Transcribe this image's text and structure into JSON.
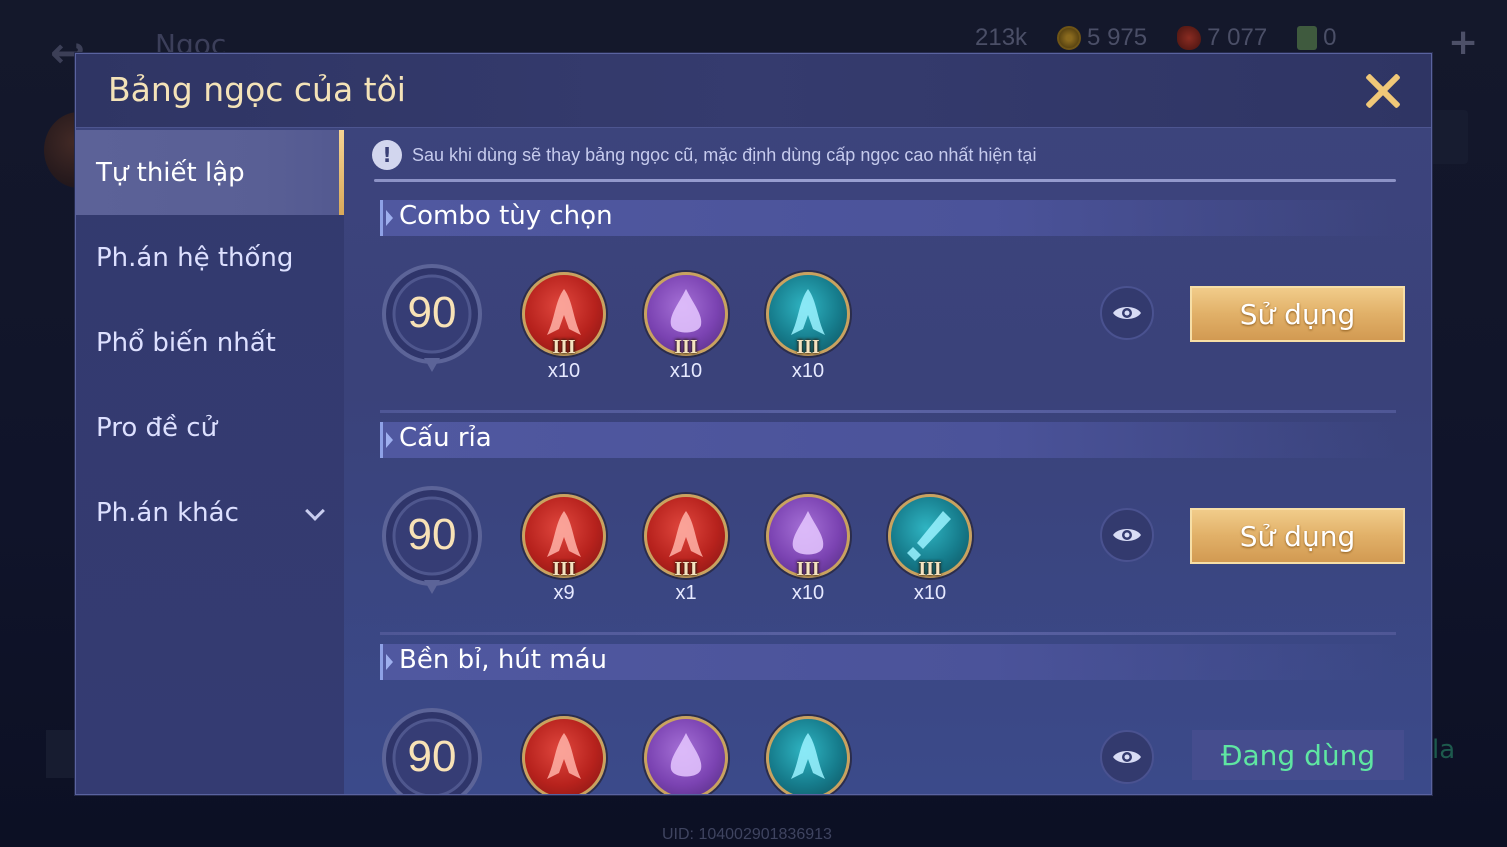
{
  "background": {
    "title": "Ngọc",
    "currencies": [
      {
        "icon": "gem-icon",
        "value": "213k"
      },
      {
        "icon": "gold-coin-icon",
        "value": "5 975"
      },
      {
        "icon": "ruby-icon",
        "value": "7 077"
      },
      {
        "icon": "card-icon",
        "value": "0"
      }
    ],
    "side_text": "la",
    "uid": "UID: 104002901836913"
  },
  "modal": {
    "title": "Bảng ngọc của tôi"
  },
  "sidebar": {
    "items": [
      {
        "label": "Tự thiết lập",
        "active": true
      },
      {
        "label": "Ph.án hệ thống",
        "active": false
      },
      {
        "label": "Phổ biến nhất",
        "active": false
      },
      {
        "label": "Pro đề cử",
        "active": false
      },
      {
        "label": "Ph.án khác",
        "active": false,
        "has_dropdown": true
      }
    ]
  },
  "notice": "Sau khi dùng sẽ thay bảng ngọc cũ, mặc định dùng cấp ngọc cao nhất hiện tại",
  "sections": [
    {
      "title": "Combo tùy chọn",
      "level": "90",
      "gems": [
        {
          "color": "red",
          "tier": "III",
          "count": "x10"
        },
        {
          "color": "purple",
          "tier": "III",
          "count": "x10"
        },
        {
          "color": "teal",
          "tier": "III",
          "count": "x10"
        }
      ],
      "action": "Sử dụng"
    },
    {
      "title": "Cấu rỉa",
      "level": "90",
      "gems": [
        {
          "color": "red",
          "tier": "III",
          "count": "x9"
        },
        {
          "color": "red",
          "tier": "III",
          "count": "x1"
        },
        {
          "color": "purple",
          "tier": "III",
          "count": "x10"
        },
        {
          "color": "teal",
          "tier": "III",
          "count": "x10"
        }
      ],
      "action": "Sử dụng"
    },
    {
      "title": "Bền bỉ, hút máu",
      "level": "90",
      "gems": [
        {
          "color": "red",
          "tier": "",
          "count": ""
        },
        {
          "color": "purple",
          "tier": "",
          "count": ""
        },
        {
          "color": "teal",
          "tier": "",
          "count": ""
        }
      ],
      "status": "Đang dùng"
    }
  ],
  "colors": {
    "accent_gold": "#f0c878",
    "active_green": "#5fe6a2",
    "modal_bg": "#3d447d"
  }
}
